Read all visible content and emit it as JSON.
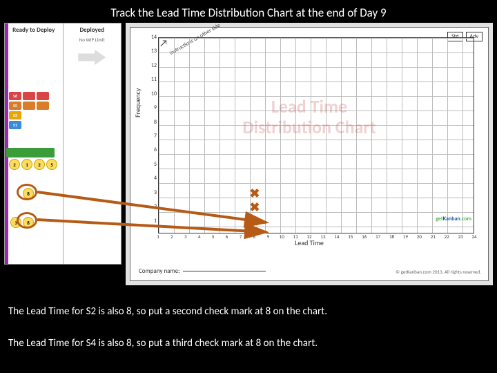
{
  "title": "Track the Lead Time Distribution Chart at the end of Day 9",
  "kanban": {
    "col1": "Ready to Deploy",
    "col2": "Deployed",
    "col2_sub": "No WIP Limit",
    "cards": {
      "row1": [
        {
          "label": "S6",
          "color": "#d94444"
        },
        {
          "label": "",
          "color": "#d94444"
        },
        {
          "label": "",
          "color": "#d94444"
        }
      ],
      "row2": [
        {
          "label": "S5",
          "color": "#d97d2b"
        },
        {
          "label": "",
          "color": "#d97d2b"
        },
        {
          "label": "",
          "color": "#d97d2b"
        }
      ],
      "row3": [
        {
          "label": "S3",
          "color": "#e6a800"
        }
      ],
      "row4": [
        {
          "label": "S1",
          "color": "#3a8bd9"
        }
      ]
    },
    "yellow_top": [
      "2",
      "1",
      "2",
      "5"
    ],
    "yellow_mid": [
      "8"
    ],
    "yellow_bot": [
      "3",
      "8"
    ]
  },
  "chart": {
    "ylabel": "Frequency",
    "xlabel": "Lead Time",
    "watermark_line1": "Lead Time",
    "watermark_line2": "Distribution Chart",
    "badges": [
      "Std",
      "Adv"
    ],
    "instructions": "Instructions on other side",
    "company_label": "Company name:",
    "brand": "getKanban.com",
    "copyright": "© getKanban.com 2013. All rights reserved."
  },
  "chart_data": {
    "type": "bar",
    "title": "Lead Time Distribution Chart",
    "xlabel": "Lead Time",
    "ylabel": "Frequency",
    "x_ticks": [
      1,
      2,
      3,
      4,
      5,
      6,
      7,
      8,
      9,
      10,
      11,
      12,
      13,
      14,
      15,
      16,
      17,
      18,
      19,
      20,
      21,
      22,
      23,
      24
    ],
    "y_ticks": [
      1,
      2,
      3,
      4,
      5,
      6,
      7,
      8,
      9,
      10,
      11,
      12,
      13,
      14
    ],
    "xlim": [
      1,
      24
    ],
    "ylim": [
      0,
      14
    ],
    "series": [
      {
        "name": "checks",
        "x": [
          8,
          8,
          8
        ],
        "y": [
          1,
          2,
          3
        ]
      }
    ]
  },
  "captions": {
    "line1": "The Lead Time for S2 is also 8, so put a second check mark at 8 on the chart.",
    "line2": "The Lead Time for S4 is also 8, so put a third check mark at 8 on the chart."
  }
}
